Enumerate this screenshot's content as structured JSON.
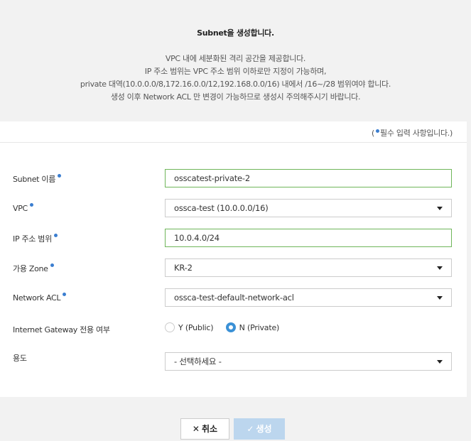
{
  "header": {
    "title": "Subnet을 생성합니다.",
    "desc": [
      "VPC 내에 세분화된 격리 공간을 제공합니다.",
      "IP 주소 범위는 VPC 주소 범위 이하로만 지정이 가능하며,",
      "private 대역(10.0.0.0/8,172.16.0.0/12,192.168.0.0/16) 내에서 /16~/28 범위여야 합니다.",
      "생성 이후 Network ACL 만 변경이 가능하므로 생성시 주의해주시기 바랍니다."
    ]
  },
  "form": {
    "required_note_open": "(",
    "required_note_text": "필수 입력 사항입니다.)",
    "subnet_name": {
      "label": "Subnet 이름",
      "value": "osscatest-private-2"
    },
    "vpc": {
      "label": "VPC",
      "selected": "ossca-test (10.0.0.0/16)"
    },
    "ip_range": {
      "label": "IP 주소 범위",
      "value": "10.0.4.0/24"
    },
    "zone": {
      "label": "가용 Zone",
      "selected": "KR-2"
    },
    "network_acl": {
      "label": "Network ACL",
      "selected": "ossca-test-default-network-acl"
    },
    "igw": {
      "label": "Internet Gateway 전용 여부",
      "options": [
        "Y (Public)",
        "N (Private)"
      ],
      "selected": "N (Private)"
    },
    "usage": {
      "label": "용도",
      "selected": "- 선택하세요 -"
    }
  },
  "actions": {
    "cancel_label": "취소",
    "create_label": "생성"
  },
  "colors": {
    "accent": "#3b91d6",
    "valid_border": "#6fb65a",
    "create_disabled": "#bcd6ee"
  }
}
